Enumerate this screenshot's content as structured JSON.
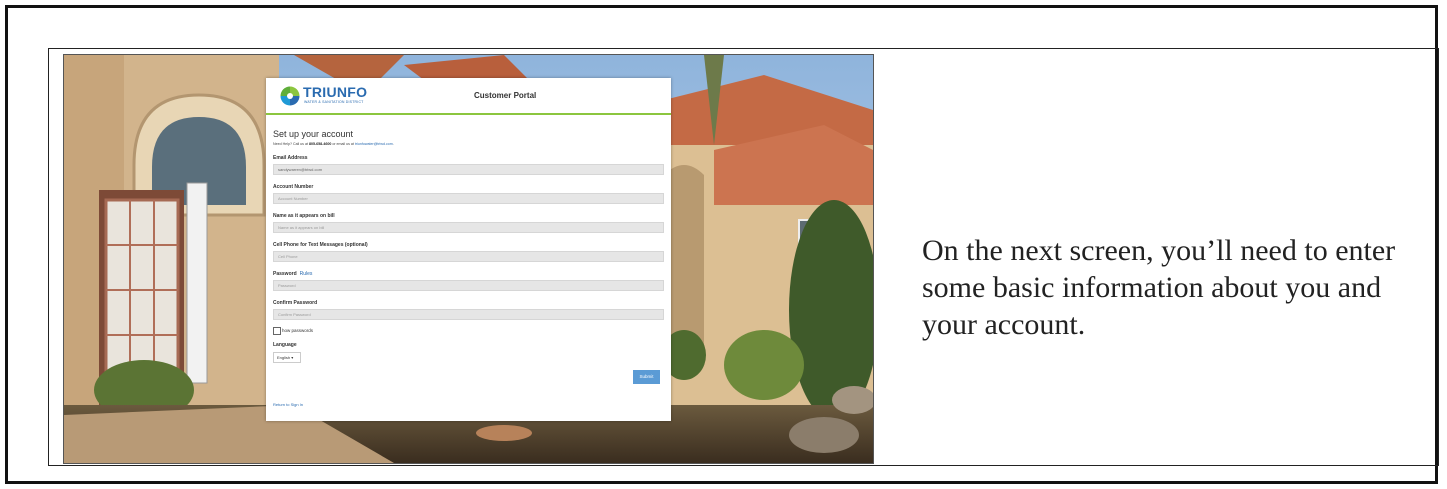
{
  "header": {
    "brand": "TRIUNFO",
    "brand_sub": "WATER & SANITATION DISTRICT",
    "portal_title": "Customer Portal"
  },
  "form": {
    "title": "Set up your account",
    "help_prefix": "Need Help? Call us at ",
    "help_phone": "805-658-4600",
    "help_middle": " or email us at ",
    "help_email": "triunfowater@triwd.com",
    "help_suffix": ".",
    "fields": [
      {
        "label": "Email Address",
        "value": "sandywarren@triwd.com",
        "placeholder": ""
      },
      {
        "label": "Account Number",
        "value": "",
        "placeholder": "Account Number"
      },
      {
        "label": "Name as it appears on bill",
        "value": "",
        "placeholder": "Name as it appears on bill"
      },
      {
        "label": "Cell Phone for Text Messages (optional)",
        "value": "",
        "placeholder": "Cell Phone"
      },
      {
        "label": "Password",
        "value": "",
        "placeholder": "Password",
        "link": "Rules"
      },
      {
        "label": "Confirm Password",
        "value": "",
        "placeholder": "Confirm Password"
      }
    ],
    "show_passwords_label": "how passwords",
    "language_label": "Language",
    "language_value": "English ▾",
    "submit_label": "Submit",
    "return_label": "Return to Sign In"
  },
  "caption": "On the next screen, you’ll need to enter some basic information about you and your account.",
  "colors": {
    "brand_blue": "#2a6bb0",
    "accent_green": "#8cc63f",
    "submit_blue": "#5b9bd5"
  }
}
